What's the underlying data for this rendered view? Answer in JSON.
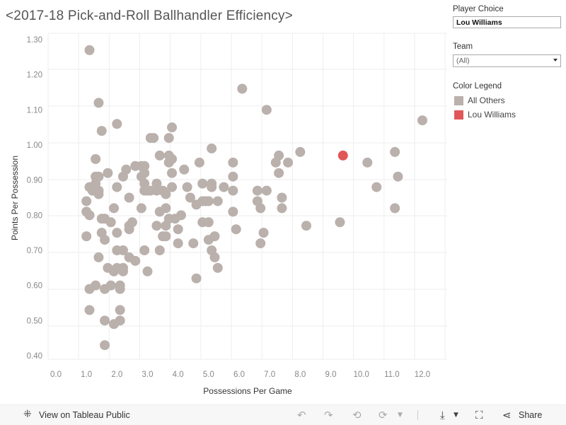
{
  "title": "<2017-18 Pick-and-Roll Ballhandler Efficiency>",
  "controls": {
    "player_choice_label": "Player Choice",
    "player_choice_value": "Lou Williams",
    "team_label": "Team",
    "team_value": "(All)",
    "legend_title": "Color Legend",
    "legend": [
      {
        "label": "All Others",
        "color": "#bab0ac"
      },
      {
        "label": "Lou Williams",
        "color": "#e15759"
      }
    ]
  },
  "toolbar": {
    "view_on": "View on Tableau Public",
    "share": "Share",
    "icons": [
      "tableau-logo-icon",
      "undo-icon",
      "redo-icon",
      "revert-icon",
      "refresh-icon",
      "download-icon",
      "fullscreen-icon",
      "share-icon"
    ]
  },
  "chart_data": {
    "type": "scatter",
    "title": "<2017-18 Pick-and-Roll Ballhandler Efficiency>",
    "xlabel": "Possessions Per Game",
    "ylabel": "Points Per Possession",
    "xlim": [
      0,
      12.8
    ],
    "ylim": [
      0.38,
      1.32
    ],
    "xticks": [
      "0.0",
      "1.0",
      "2.0",
      "3.0",
      "4.0",
      "5.0",
      "6.0",
      "7.0",
      "8.0",
      "9.0",
      "10.0",
      "11.0",
      "12.0"
    ],
    "yticks": [
      "0.40",
      "0.50",
      "0.60",
      "0.70",
      "0.80",
      "0.90",
      "1.00",
      "1.10",
      "1.20",
      "1.30"
    ],
    "grid": true,
    "series": [
      {
        "name": "All Others",
        "color": "#bab0ac",
        "points": [
          [
            1.1,
            1.27
          ],
          [
            1.4,
            1.12
          ],
          [
            1.5,
            1.04
          ],
          [
            2.0,
            1.06
          ],
          [
            3.1,
            1.02
          ],
          [
            3.2,
            1.02
          ],
          [
            3.7,
            1.02
          ],
          [
            3.8,
            1.05
          ],
          [
            6.1,
            1.16
          ],
          [
            6.9,
            1.1
          ],
          [
            12.0,
            1.07
          ],
          [
            1.3,
            0.96
          ],
          [
            3.4,
            0.97
          ],
          [
            3.7,
            0.97
          ],
          [
            3.8,
            0.96
          ],
          [
            3.7,
            0.95
          ],
          [
            5.1,
            0.99
          ],
          [
            4.7,
            0.95
          ],
          [
            5.8,
            0.95
          ],
          [
            7.3,
            0.97
          ],
          [
            7.2,
            0.95
          ],
          [
            7.6,
            0.95
          ],
          [
            8.0,
            0.98
          ],
          [
            11.1,
            0.98
          ],
          [
            10.2,
            0.95
          ],
          [
            1.3,
            0.91
          ],
          [
            1.4,
            0.91
          ],
          [
            1.7,
            0.92
          ],
          [
            1.1,
            0.88
          ],
          [
            1.3,
            0.89
          ],
          [
            1.4,
            0.87
          ],
          [
            1.4,
            0.86
          ],
          [
            1.2,
            0.87
          ],
          [
            2.2,
            0.91
          ],
          [
            2.3,
            0.93
          ],
          [
            2.6,
            0.94
          ],
          [
            2.8,
            0.94
          ],
          [
            2.9,
            0.94
          ],
          [
            2.8,
            0.91
          ],
          [
            2.9,
            0.92
          ],
          [
            2.0,
            0.88
          ],
          [
            2.9,
            0.89
          ],
          [
            3.3,
            0.89
          ],
          [
            3.8,
            0.92
          ],
          [
            4.2,
            0.93
          ],
          [
            3.8,
            0.88
          ],
          [
            4.3,
            0.88
          ],
          [
            4.8,
            0.89
          ],
          [
            5.1,
            0.89
          ],
          [
            5.1,
            0.88
          ],
          [
            5.5,
            0.88
          ],
          [
            5.8,
            0.91
          ],
          [
            5.8,
            0.87
          ],
          [
            6.6,
            0.87
          ],
          [
            6.9,
            0.87
          ],
          [
            7.3,
            0.92
          ],
          [
            11.2,
            0.91
          ],
          [
            10.5,
            0.88
          ],
          [
            1.0,
            0.84
          ],
          [
            1.0,
            0.81
          ],
          [
            1.1,
            0.8
          ],
          [
            1.5,
            0.79
          ],
          [
            1.6,
            0.79
          ],
          [
            1.9,
            0.82
          ],
          [
            2.4,
            0.85
          ],
          [
            2.9,
            0.87
          ],
          [
            3.0,
            0.87
          ],
          [
            3.1,
            0.87
          ],
          [
            3.3,
            0.87
          ],
          [
            3.5,
            0.87
          ],
          [
            3.6,
            0.86
          ],
          [
            2.8,
            0.82
          ],
          [
            3.4,
            0.81
          ],
          [
            3.6,
            0.82
          ],
          [
            3.7,
            0.79
          ],
          [
            3.9,
            0.79
          ],
          [
            4.1,
            0.8
          ],
          [
            4.4,
            0.85
          ],
          [
            4.6,
            0.83
          ],
          [
            4.8,
            0.84
          ],
          [
            4.9,
            0.84
          ],
          [
            5.0,
            0.84
          ],
          [
            5.3,
            0.84
          ],
          [
            5.8,
            0.81
          ],
          [
            6.6,
            0.84
          ],
          [
            6.7,
            0.82
          ],
          [
            7.4,
            0.85
          ],
          [
            7.4,
            0.82
          ],
          [
            11.1,
            0.82
          ],
          [
            1.0,
            0.74
          ],
          [
            1.5,
            0.75
          ],
          [
            1.6,
            0.73
          ],
          [
            1.8,
            0.78
          ],
          [
            2.0,
            0.75
          ],
          [
            2.4,
            0.76
          ],
          [
            2.4,
            0.77
          ],
          [
            2.5,
            0.78
          ],
          [
            3.3,
            0.77
          ],
          [
            3.6,
            0.77
          ],
          [
            3.6,
            0.74
          ],
          [
            3.5,
            0.74
          ],
          [
            4.0,
            0.76
          ],
          [
            4.0,
            0.72
          ],
          [
            4.5,
            0.72
          ],
          [
            4.8,
            0.78
          ],
          [
            5.0,
            0.78
          ],
          [
            5.0,
            0.73
          ],
          [
            5.2,
            0.74
          ],
          [
            5.9,
            0.76
          ],
          [
            6.7,
            0.72
          ],
          [
            6.8,
            0.75
          ],
          [
            8.2,
            0.77
          ],
          [
            9.3,
            0.78
          ],
          [
            1.4,
            0.68
          ],
          [
            2.0,
            0.7
          ],
          [
            2.2,
            0.7
          ],
          [
            2.4,
            0.68
          ],
          [
            2.6,
            0.67
          ],
          [
            2.9,
            0.7
          ],
          [
            3.4,
            0.7
          ],
          [
            5.1,
            0.7
          ],
          [
            5.2,
            0.68
          ],
          [
            5.3,
            0.65
          ],
          [
            1.7,
            0.65
          ],
          [
            1.9,
            0.64
          ],
          [
            2.0,
            0.65
          ],
          [
            2.2,
            0.65
          ],
          [
            2.2,
            0.64
          ],
          [
            3.0,
            0.64
          ],
          [
            4.6,
            0.62
          ],
          [
            1.1,
            0.59
          ],
          [
            1.3,
            0.6
          ],
          [
            1.6,
            0.59
          ],
          [
            1.8,
            0.6
          ],
          [
            2.1,
            0.6
          ],
          [
            2.1,
            0.59
          ],
          [
            1.1,
            0.53
          ],
          [
            2.1,
            0.53
          ],
          [
            1.6,
            0.5
          ],
          [
            1.9,
            0.49
          ],
          [
            2.1,
            0.5
          ],
          [
            1.6,
            0.43
          ]
        ]
      },
      {
        "name": "Lou Williams",
        "color": "#e15759",
        "points": [
          [
            9.4,
            0.97
          ]
        ]
      }
    ]
  }
}
